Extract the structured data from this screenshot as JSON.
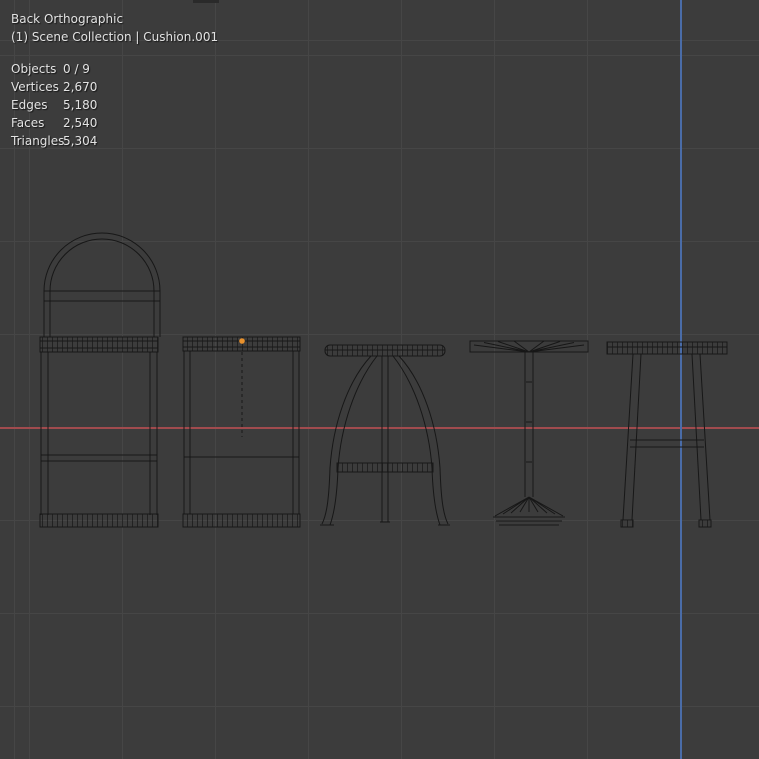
{
  "header": {
    "view_label": "Back Orthographic",
    "context_label": "(1) Scene Collection | Cushion.001"
  },
  "stats": {
    "rows": [
      {
        "label": "Objects",
        "value": "0 / 9"
      },
      {
        "label": "Vertices",
        "value": "2,670"
      },
      {
        "label": "Edges",
        "value": "5,180"
      },
      {
        "label": "Faces",
        "value": "2,540"
      },
      {
        "label": "Triangles",
        "value": "5,304"
      }
    ]
  },
  "colors": {
    "viewport-bg": "#3c3c3c",
    "grid-line": "#464646",
    "axis-x": "#a14b4e",
    "axis-z": "#4a6ca8",
    "wireframe": "#171717",
    "origin-dot": "#e8912d",
    "overlay-text": "#e3e3e3"
  }
}
